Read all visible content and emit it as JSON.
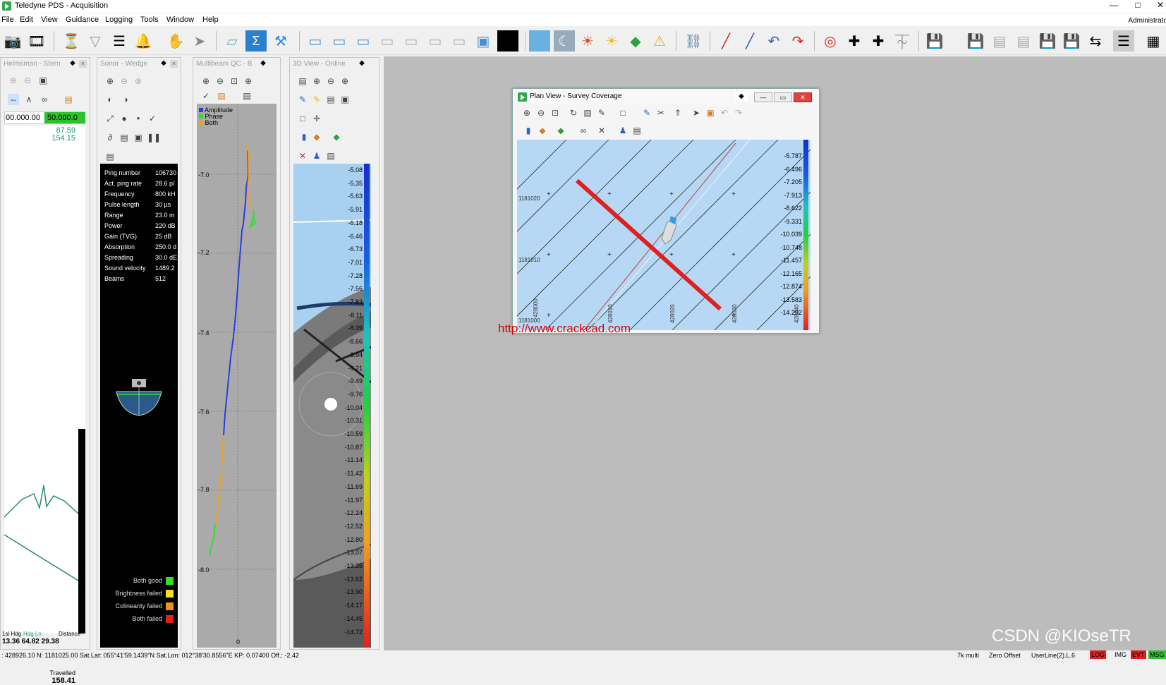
{
  "window": {
    "title": "Teledyne PDS - Acquisition",
    "user": "Administrato"
  },
  "menu": [
    "File",
    "Edit",
    "View",
    "Guidance",
    "Logging",
    "Tools",
    "Window",
    "Help"
  ],
  "toolbar_icons": [
    "camera-icon",
    "film-reel-icon",
    "filter-funnel-icon",
    "filter-icon",
    "sliders-icon",
    "bell-icon",
    "hand-icon",
    "pointer-icon",
    "eraser-icon",
    "sigma-icon",
    "tool-icon",
    "window-icon",
    "window-add-icon",
    "window-info-icon",
    "window-a-icon",
    "window-b-icon",
    "window-c-icon",
    "window-d-icon",
    "chart-window-icon",
    "black-square-icon",
    "sky-icon",
    "night-icon",
    "sun-icon",
    "sun-bright-icon",
    "palette-icon",
    "warning-icon",
    "link-icon",
    "line-cursor-icon",
    "line-edit-icon",
    "line-rotate-icon",
    "line-delete-icon",
    "lifebuoy-icon",
    "target-plus-icon",
    "add-icon",
    "tide-icon",
    "save-icon",
    "save-check-icon",
    "save-wcs-icon",
    "save-img-icon",
    "save-green-icon",
    "save-lock-icon",
    "save-arrows-icon",
    "list-check-icon",
    "layers-icon"
  ],
  "panels": {
    "helmsman": {
      "title": "Helmsman - Stern",
      "left_value": "00.000.00",
      "right_value": "50.000.0",
      "readout1": "87.59",
      "readout2": "154.15",
      "travelled_label": "Travelled",
      "travelled_value": "158.41",
      "bottom_left": "1sl Hdg",
      "bottom_mid": "Hdg Ln",
      "bottom_right": "Distance",
      "bottom_vals": "13.36 64.82 29.38"
    },
    "sonar": {
      "title": "Sonar - Wedge",
      "stats": [
        {
          "label": "Ping number",
          "value": "106730"
        },
        {
          "label": "Act. ping rate",
          "value": "28.6 p/"
        },
        {
          "label": "Frequency",
          "value": "800 kH"
        },
        {
          "label": "Pulse length",
          "value": "30 µs"
        },
        {
          "label": "Range",
          "value": "23.0 m"
        },
        {
          "label": "Power",
          "value": "220 dB"
        },
        {
          "label": "Gain (TVG)",
          "value": "25 dB"
        },
        {
          "label": "Absorption",
          "value": "250.0 d"
        },
        {
          "label": "Spreading",
          "value": "30.0 dE"
        },
        {
          "label": "Sound velocity",
          "value": "1489.2"
        },
        {
          "label": "Beams",
          "value": "512"
        }
      ],
      "legend": [
        {
          "label": "Both good",
          "color": "#2ee02e"
        },
        {
          "label": "Brightness failed",
          "color": "#f0e020"
        },
        {
          "label": "Colinearity failed",
          "color": "#f09020"
        },
        {
          "label": "Both failed",
          "color": "#e02020"
        }
      ]
    },
    "multibeam": {
      "title": "Multibeam QC - B",
      "legend": [
        {
          "label": "Amplitude",
          "color": "#2b3fe0"
        },
        {
          "label": "Phase",
          "color": "#2ee02e"
        },
        {
          "label": "Both",
          "color": "#f0a020"
        }
      ],
      "y_ticks": [
        "-7.0",
        "-7.2",
        "-7.4",
        "-7.6",
        "-7.8",
        "-8.0"
      ],
      "bottom_tick": "0"
    },
    "view3d": {
      "title": "3D View - Online",
      "scale": [
        "-5.08",
        "-5.35",
        "-5.63",
        "-5.91",
        "-6.18",
        "-6.46",
        "-6.73",
        "-7.01",
        "-7.28",
        "-7.56",
        "-7.83",
        "-8.11",
        "-8.39",
        "-8.66",
        "-8.94",
        "-9.21",
        "-9.49",
        "-9.76",
        "-10.04",
        "-10.31",
        "-10.59",
        "-10.87",
        "-11.14",
        "-11.42",
        "-11.69",
        "-11.97",
        "-12.24",
        "-12.52",
        "-12.80",
        "-13.07",
        "-13.35",
        "-13.62",
        "-13.90",
        "-14.17",
        "-14.45",
        "-14.72"
      ]
    },
    "planview": {
      "title": "Plan View - Survey Coverage",
      "y_labels": [
        "1181020",
        "1181010",
        "1181000"
      ],
      "x_labels": [
        "428000",
        "428010",
        "428020",
        "428030",
        "428040"
      ],
      "scale": [
        "-5.787",
        "-6.496",
        "-7.205",
        "-7.913",
        "-8.622",
        "-9.331",
        "-10.039",
        "-10.748",
        "-11.457",
        "-12.165",
        "-12.874",
        "-13.583",
        "-14.292"
      ]
    }
  },
  "watermark": "http://www.crackcad.com",
  "csdn": "CSDN @KIOseTR",
  "status": {
    "coords": ": 428926.10 N: 1181025.00 Sat.Lat: 055°41'59.1439\"N Sat.Lon: 012°38'30.8556\"E KP: 0.07400 Off.: -2.42",
    "right1": "7k multi",
    "right2": "Zero Offset",
    "right3": "UserLine(2).L.6",
    "badges": [
      {
        "label": "LOG",
        "color": "#e02020"
      },
      {
        "label": "IMG",
        "color": "#f0f0f0"
      },
      {
        "label": "EVT",
        "color": "#e02020"
      },
      {
        "label": "MSG",
        "color": "#2ec02e"
      }
    ]
  }
}
